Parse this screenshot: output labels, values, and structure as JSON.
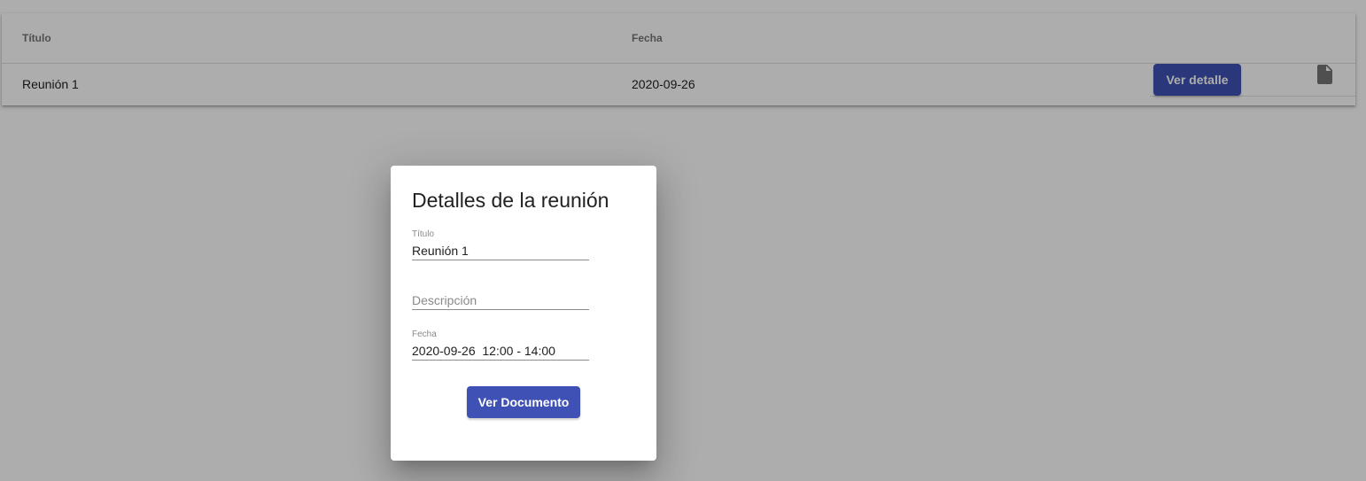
{
  "table": {
    "columns": {
      "title": "Título",
      "date": "Fecha"
    },
    "rows": [
      {
        "title": "Reunión 1",
        "date": "2020-09-26",
        "action_label": "Ver detalle",
        "icon": "document-icon"
      }
    ]
  },
  "dialog": {
    "title": "Detalles de la reunión",
    "fields": {
      "title": {
        "label": "Título",
        "value": "Reunión 1"
      },
      "description": {
        "placeholder": "Descripción",
        "value": ""
      },
      "date": {
        "label": "Fecha",
        "value": "2020-09-26  12:00 - 14:00"
      }
    },
    "button_label": "Ver Documento"
  },
  "colors": {
    "primary": "#3f51b5",
    "backdrop": "rgba(0,0,0,0.32)"
  }
}
